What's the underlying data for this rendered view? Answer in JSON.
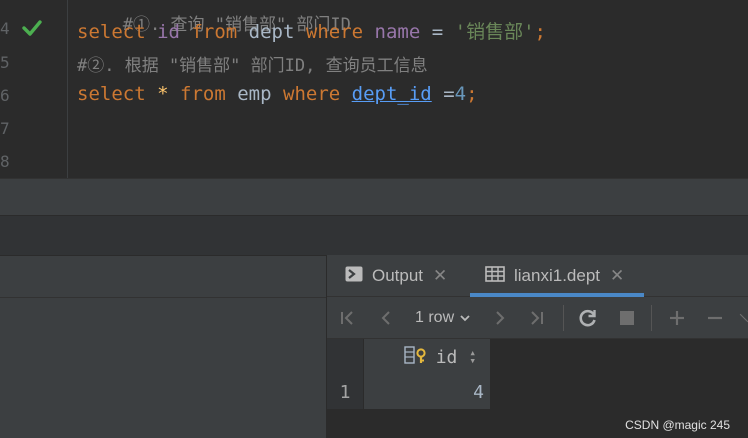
{
  "editor": {
    "top_partial": "#①. 查询 \"销售部\" 部门ID",
    "line_numbers": [
      "4",
      "5",
      "6",
      "7",
      "8"
    ],
    "line4": {
      "kw1": "select",
      "col1": "id",
      "kw2": "from",
      "tbl": "dept",
      "kw3": "where",
      "col2": "name",
      "op": "=",
      "str": "'销售部'",
      "semi": ";"
    },
    "line5": {
      "comment": "#②. 根据 \"销售部\" 部门ID, 查询员工信息"
    },
    "line6": {
      "kw1": "select",
      "star": "*",
      "kw2": "from",
      "tbl": "emp",
      "kw3": "where",
      "col": "dept_id",
      "op": "=",
      "num": "4",
      "semi": ";"
    }
  },
  "results": {
    "tabs": [
      {
        "label": "Output",
        "icon": "console-icon"
      },
      {
        "label": "lianxi1.dept",
        "icon": "table-icon"
      }
    ],
    "toolbar": {
      "row_count": "1 row",
      "icons": [
        "first-page-icon",
        "prev-page-icon",
        "next-page-icon",
        "last-page-icon",
        "refresh-icon",
        "stop-icon",
        "add-row-icon",
        "delete-row-icon"
      ]
    },
    "grid": {
      "columns": [
        "id"
      ],
      "rows": [
        {
          "row_no": "1",
          "cells": [
            "4"
          ]
        }
      ]
    }
  },
  "watermark": "CSDN @magic 245",
  "colors": {
    "keyword": "#cc7832",
    "column": "#9876aa",
    "string": "#6a8759",
    "number": "#6897bb",
    "link": "#589df6",
    "tab_underline": "#4a88c7",
    "check": "#4caf50"
  }
}
